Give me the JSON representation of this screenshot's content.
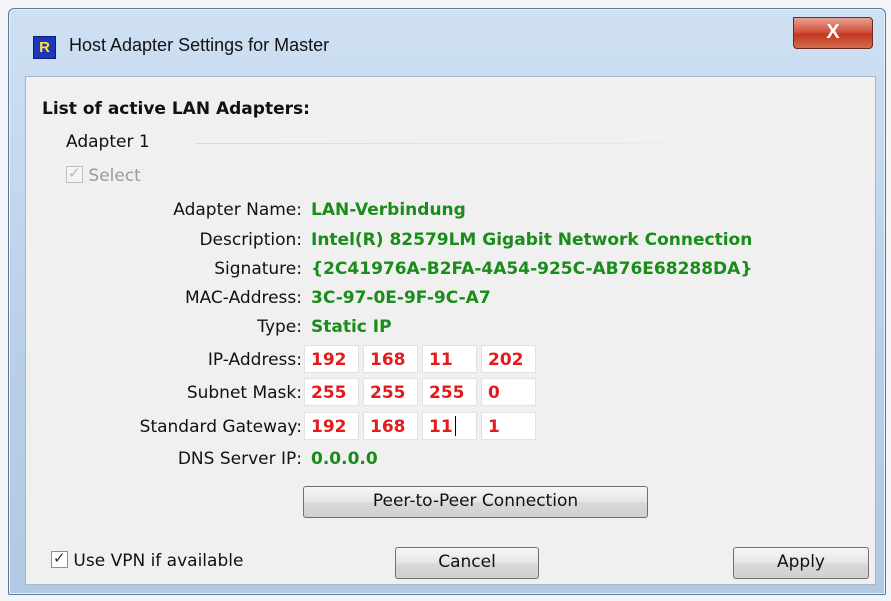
{
  "window": {
    "title": "Host Adapter Settings for Master",
    "app_icon_glyph": "R",
    "close_glyph": "X"
  },
  "section_title": "List of active LAN Adapters:",
  "adapter": {
    "label": "Adapter 1",
    "select_label": "Select",
    "select_checked": true,
    "select_enabled": false,
    "fields": {
      "adapter_name_label": "Adapter Name:",
      "adapter_name": "LAN-Verbindung",
      "description_label": "Description:",
      "description": "Intel(R) 82579LM Gigabit Network Connection",
      "signature_label": "Signature:",
      "signature": "{2C41976A-B2FA-4A54-925C-AB76E68288DA}",
      "mac_label": "MAC-Address:",
      "mac": "3C-97-0E-9F-9C-A7",
      "type_label": "Type:",
      "type": "Static IP",
      "ip_label": "IP-Address:",
      "ip": [
        "192",
        "168",
        "11",
        "202"
      ],
      "subnet_label": "Subnet Mask:",
      "subnet": [
        "255",
        "255",
        "255",
        "0"
      ],
      "gateway_label": "Standard Gateway:",
      "gateway": [
        "192",
        "168",
        "11",
        "1"
      ],
      "dns_label": "DNS Server IP:",
      "dns": "0.0.0.0"
    }
  },
  "buttons": {
    "peer": "Peer-to-Peer Connection",
    "cancel": "Cancel",
    "apply": "Apply"
  },
  "vpn": {
    "label": "Use VPN if available",
    "checked": true
  },
  "colors": {
    "value_green": "#1a8c1a",
    "ip_red": "#e31b1b",
    "title_bar": "#b8cfe9",
    "close_red": "#c2381f"
  }
}
